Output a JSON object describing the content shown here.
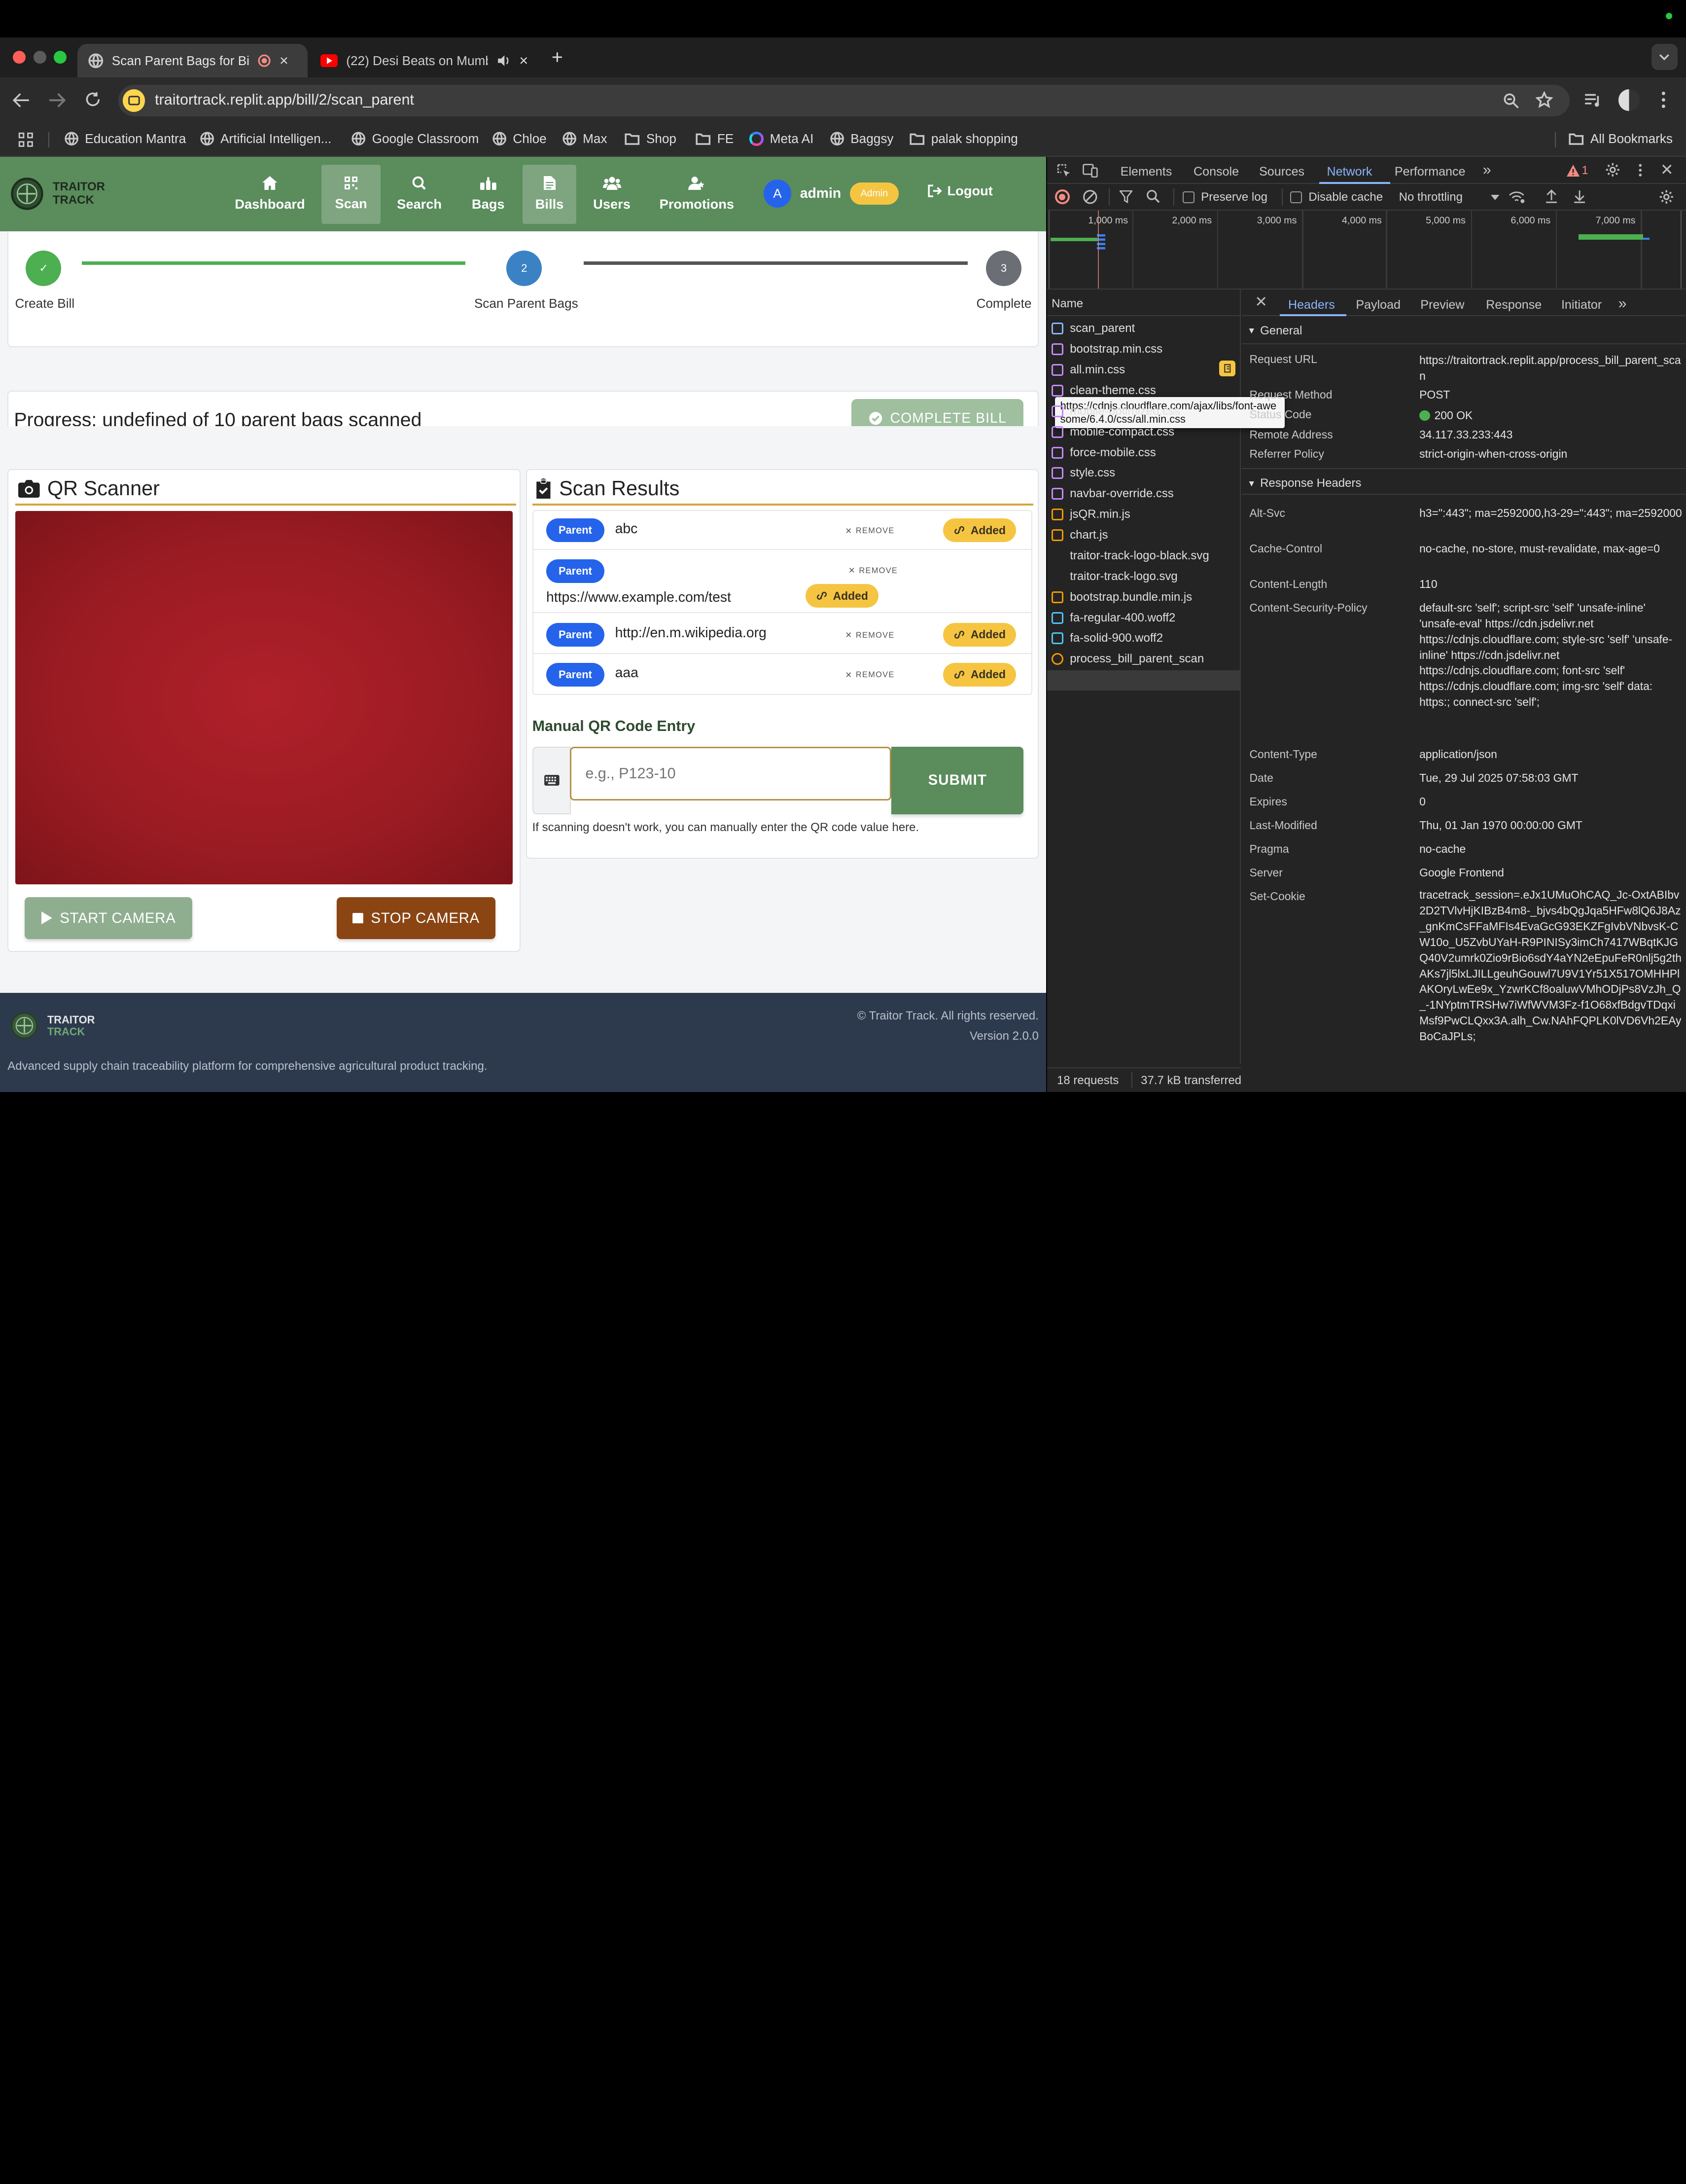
{
  "browser": {
    "tabs": [
      {
        "title": "Scan Parent Bags for Bill",
        "active": true
      },
      {
        "title": "(22) Desi Beats on Mumba",
        "active": false
      }
    ],
    "url": "traitortrack.replit.app/bill/2/scan_parent",
    "bookmarks": [
      "Education Mantra",
      "Artificial Intelligen...",
      "Google Classroom",
      "Chloe",
      "Max",
      "Shop",
      "FE",
      "Meta AI",
      "Baggsy",
      "palak shopping"
    ],
    "all_bookmarks": "All Bookmarks"
  },
  "app": {
    "brand_line1": "TRAITOR",
    "brand_line2": "TRACK",
    "nav": [
      {
        "label": "Dashboard",
        "icon": "home-icon",
        "active": false
      },
      {
        "label": "Scan",
        "icon": "qr-icon",
        "active": true
      },
      {
        "label": "Search",
        "icon": "search-icon",
        "active": false
      },
      {
        "label": "Bags",
        "icon": "bags-icon",
        "active": false
      },
      {
        "label": "Bills",
        "icon": "bill-icon",
        "active": true
      },
      {
        "label": "Users",
        "icon": "users-icon",
        "active": false
      },
      {
        "label": "Promotions",
        "icon": "promotions-icon",
        "active": false
      }
    ],
    "user": {
      "avatar": "A",
      "name": "admin",
      "role": "Admin"
    },
    "logout": "Logout"
  },
  "stepper": {
    "steps": [
      {
        "number": "✓",
        "label": "Create Bill",
        "state": "done"
      },
      {
        "number": "2",
        "label": "Scan Parent Bags",
        "state": "current"
      },
      {
        "number": "3",
        "label": "Complete",
        "state": "pending"
      }
    ]
  },
  "progress": {
    "text": "Progress: undefined of 10 parent bags scanned",
    "complete_button": "COMPLETE BILL"
  },
  "qr_scanner": {
    "title": "QR Scanner",
    "start_button": "START CAMERA",
    "stop_button": "STOP CAMERA"
  },
  "scan_results": {
    "title": "Scan Results",
    "remove_label": "REMOVE",
    "added_label": "Added",
    "items": [
      {
        "type": "Parent",
        "value": "abc"
      },
      {
        "type": "Parent",
        "value": "https://www.example.com/test"
      },
      {
        "type": "Parent",
        "value": "http://en.m.wikipedia.org"
      },
      {
        "type": "Parent",
        "value": "aaa"
      }
    ]
  },
  "manual_entry": {
    "title": "Manual QR Code Entry",
    "placeholder": "e.g., P123-10",
    "submit": "SUBMIT",
    "help": "If scanning doesn't work, you can manually enter the QR code value here."
  },
  "footer": {
    "brand_line1": "TRAITOR",
    "brand_line2": "TRACK",
    "copyright": "© Traitor Track. All rights reserved.",
    "version": "Version 2.0.0",
    "tagline": "Advanced supply chain traceability platform for comprehensive agricultural product tracking."
  },
  "devtools": {
    "tabs": [
      "Elements",
      "Console",
      "Sources",
      "Network",
      "Performance"
    ],
    "active_tab": "Network",
    "issues_count": "1",
    "preserve_log": "Preserve log",
    "disable_cache": "Disable cache",
    "throttling": "No throttling",
    "timeline_ticks": [
      "1,000 ms",
      "2,000 ms",
      "3,000 ms",
      "4,000 ms",
      "5,000 ms",
      "6,000 ms",
      "7,000 ms"
    ],
    "name_header": "Name",
    "requests": [
      {
        "name": "scan_parent",
        "type": "doc"
      },
      {
        "name": "bootstrap.min.css",
        "type": "css"
      },
      {
        "name": "all.min.css",
        "type": "css"
      },
      {
        "name": "clean-theme.css",
        "type": "css"
      },
      {
        "name": "mobile-optimized.css",
        "type": "css"
      },
      {
        "name": "mobile-compact.css",
        "type": "css"
      },
      {
        "name": "force-mobile.css",
        "type": "css"
      },
      {
        "name": "style.css",
        "type": "css"
      },
      {
        "name": "navbar-override.css",
        "type": "css"
      },
      {
        "name": "jsQR.min.js",
        "type": "js"
      },
      {
        "name": "chart.js",
        "type": "js"
      },
      {
        "name": "traitor-track-logo-black.svg",
        "type": "img"
      },
      {
        "name": "traitor-track-logo.svg",
        "type": "img"
      },
      {
        "name": "bootstrap.bundle.min.js",
        "type": "js"
      },
      {
        "name": "fa-regular-400.woff2",
        "type": "font"
      },
      {
        "name": "fa-solid-900.woff2",
        "type": "font"
      },
      {
        "name": "process_bill_parent_scan",
        "type": "fetch"
      }
    ],
    "tooltip": "https://cdnjs.cloudflare.com/ajax/libs/font-awesome/6.4.0/css/all.min.css",
    "status_requests": "18 requests",
    "status_transferred": "37.7 kB transferred",
    "detail_tabs": [
      "Headers",
      "Payload",
      "Preview",
      "Response",
      "Initiator"
    ],
    "general_title": "General",
    "general": [
      {
        "key": "Request URL",
        "value": "https://traitortrack.replit.app/process_bill_parent_scan"
      },
      {
        "key": "Request Method",
        "value": "POST"
      },
      {
        "key": "Status Code",
        "value": "200 OK"
      },
      {
        "key": "Remote Address",
        "value": "34.117.33.233:443"
      },
      {
        "key": "Referrer Policy",
        "value": "strict-origin-when-cross-origin"
      }
    ],
    "response_headers_title": "Response Headers",
    "response_headers": [
      {
        "key": "Alt-Svc",
        "value": "h3=\":443\"; ma=2592000,h3-29=\":443\"; ma=2592000"
      },
      {
        "key": "Cache-Control",
        "value": "no-cache, no-store, must-revalidate, max-age=0"
      },
      {
        "key": "Content-Length",
        "value": "110"
      },
      {
        "key": "Content-Security-Policy",
        "value": "default-src 'self'; script-src 'self' 'unsafe-inline' 'unsafe-eval' https://cdn.jsdelivr.net https://cdnjs.cloudflare.com; style-src 'self' 'unsafe-inline' https://cdn.jsdelivr.net https://cdnjs.cloudflare.com; font-src 'self' https://cdnjs.cloudflare.com; img-src 'self' data: https:; connect-src 'self';"
      },
      {
        "key": "Content-Type",
        "value": "application/json"
      },
      {
        "key": "Date",
        "value": "Tue, 29 Jul 2025 07:58:03 GMT"
      },
      {
        "key": "Expires",
        "value": "0"
      },
      {
        "key": "Last-Modified",
        "value": "Thu, 01 Jan 1970 00:00:00 GMT"
      },
      {
        "key": "Pragma",
        "value": "no-cache"
      },
      {
        "key": "Server",
        "value": "Google Frontend"
      },
      {
        "key": "Set-Cookie",
        "value": "tracetrack_session=.eJx1UMuOhCAQ_Jc-OxtABIbv2D2TVlvHjKIBzB4m8-_bjvs4bQgJqa5HFw8lQ6J8Az_gnKmCsFFaMFIs4EvaGcG93EKZFgIvbVNbvsK-CW10o_U5ZvbUYaH-R9PINISy3imCh7417WBqtKJGQ40V2umrk0Zio9rBio6sdY4aYN2eEpuFeR0nlj5g2thAKs7jl5lxLJILLgeuhGouwl7U9V1Yr51X517OMHHPlAKOryLwEe9x_YzwrKCf8oaluwVMhODjPs8VzJh_Q_-1NYptmTRSHw7iWfWVM3Fz-f1O68xfBdgvTDqxiMsf9PwCLQxx3A.alh_Cw.NAhFQPLK0lVD6Vh2EAyBoCaJPLs;"
      }
    ]
  }
}
